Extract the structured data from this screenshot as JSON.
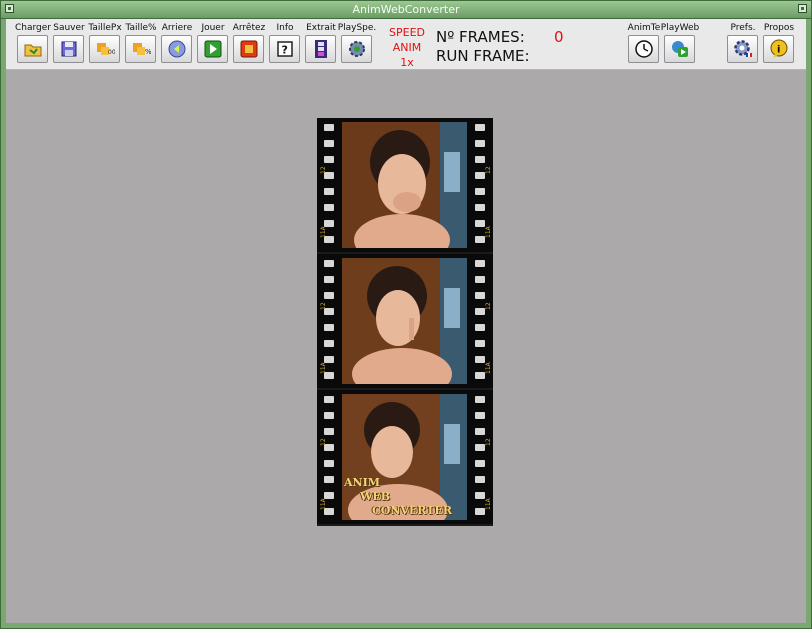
{
  "window": {
    "title": "AnimWebConverter"
  },
  "toolbar": {
    "buttons": [
      {
        "label": "Charger",
        "icon": "folder-icon"
      },
      {
        "label": "Sauver",
        "icon": "floppy-save-icon"
      },
      {
        "label": "TaillePx",
        "icon": "resize-px-icon"
      },
      {
        "label": "Taille%",
        "icon": "resize-percent-icon"
      },
      {
        "label": "Arriere",
        "icon": "back-arrow-icon"
      },
      {
        "label": "Jouer",
        "icon": "play-icon"
      },
      {
        "label": "Arrêtez",
        "icon": "stop-icon"
      },
      {
        "label": "Info",
        "icon": "question-icon"
      },
      {
        "label": "Extrait",
        "icon": "film-extract-icon"
      },
      {
        "label": "PlaySpe.",
        "icon": "gear-play-icon"
      }
    ],
    "speed": {
      "line1": "SPEED",
      "line2": "ANIM",
      "line3": "1x"
    },
    "frames_label": "Nº FRAMES:",
    "frames_value": "0",
    "run_frame_label": "RUN FRAME:",
    "right_buttons": [
      {
        "label": "AnimTe",
        "icon": "clock-time-icon"
      },
      {
        "label": "PlayWeb",
        "icon": "web-play-icon"
      },
      {
        "label": "Prefs.",
        "icon": "gear-prefs-icon"
      },
      {
        "label": "Propos",
        "icon": "info-bubble-icon"
      }
    ]
  },
  "filmstrip": {
    "edge_top": "12",
    "edge_bottom": "11A",
    "logo": {
      "line1": "ANIM",
      "line2": "WEB",
      "line3": "CONVERTER"
    }
  },
  "colors": {
    "title_green": "#7aa872",
    "toolbar_bg": "#e9e9ea",
    "content_bg": "#aba9aa",
    "speed_red": "#e01010"
  }
}
